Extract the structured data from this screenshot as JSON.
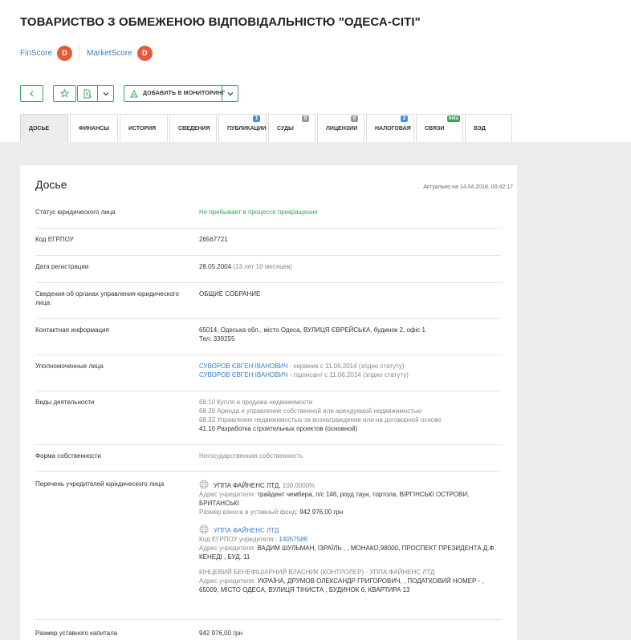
{
  "company": {
    "title": "ТОВАРИСТВО З ОБМЕЖЕНОЮ ВІДПОВІДАЛЬНІСТЮ \"ОДЕСА-СІТІ\""
  },
  "scores": [
    {
      "label": "FinScore",
      "grade": "D"
    },
    {
      "label": "MarketScore",
      "grade": "D"
    }
  ],
  "toolbar": {
    "monitor_label": "ДОБАВИТЬ В МОНИТОРИНГ"
  },
  "tabs": [
    {
      "label": "ДОСЬЕ"
    },
    {
      "label": "ФИНАНСЫ"
    },
    {
      "label": "ИСТОРИЯ"
    },
    {
      "label": "СВЕДЕНИЯ"
    },
    {
      "label": "ПУБЛИКАЦИИ",
      "badge": "1"
    },
    {
      "label": "СУДЫ",
      "badge": "0"
    },
    {
      "label": "ЛИЦЕНЗИИ",
      "badge": "0"
    },
    {
      "label": "НАЛОГОВАЯ",
      "badge": "2"
    },
    {
      "label": "СВЯЗИ",
      "badge": "beta"
    },
    {
      "label": "ВЭД"
    }
  ],
  "colors": {
    "accent": "#39a85a",
    "link": "#3a7ec2",
    "score": "#e65a3c",
    "badge_blue": "#4a90d9",
    "badge_gray": "#9a9a9a",
    "badge_green": "#3aa55a"
  },
  "dossier": {
    "title": "Досье",
    "updated": "Актуально на 14.04.2018, 00:42:17",
    "status": {
      "label": "Статус юридического лица",
      "value": "Не пребывает в процессе прекращения"
    },
    "edrpou": {
      "label": "Код ЕГРПОУ",
      "value": "26567721"
    },
    "registration": {
      "label": "Дата регистрации",
      "date": "28.05.2004",
      "age": "(13 лет 10 месяцев)"
    },
    "governance": {
      "label": "Сведения об органах управления юридического лица",
      "value": "ОБЩИЕ СОБРАНИЕ"
    },
    "contacts": {
      "label": "Контактная информация",
      "address": "65014, Одеська обл., місто Одеса, ВУЛИЦЯ ЄВРЕЙСЬКА, будинок 2, офіс 1",
      "phone": "Тел: 339255"
    },
    "authorized": {
      "label": "Уполномоченные лица",
      "persons": [
        {
          "name": "СУВОРОВ ЄВГЕН ІВАНОВИЧ",
          "role": " - керівник с 11.06.2014 (згідно статуту)"
        },
        {
          "name": "СУВОРОВ ЄВГЕН ІВАНОВИЧ",
          "role": " - підписант с 11.06.2014 (згідно статуту)"
        }
      ]
    },
    "activities": {
      "label": "Виды деятельности",
      "items": [
        "68.10 Купля и продажа недвижимости",
        "68.20 Аренда и управление собственной или арендуемой недвижимостью",
        "68.32 Управление недвижимостью за вознаграждение или на договорной основе",
        "41.10 Разработка строительных проектов (основной)"
      ]
    },
    "ownership": {
      "label": "Форма собственности",
      "value": "Негосударственная собственность"
    },
    "founders": {
      "label": "Перечень учредителей юридического лица",
      "f1_name": "УППА ФАЙНЕНС ЛТД,",
      "f1_share": "100,0000%",
      "f1_addr_label": "Адрес учредителя:",
      "f1_addr": "трайдент чембера, п/с 146, роуд таун, тортола, ВІРГІНСЬКІ ОСТРОВИ, БРИТАНСЬКІ",
      "f1_fund_label": "Размер взноса в уставный фонд:",
      "f1_fund": "942 976,00 грн",
      "f2_name": "УППА ФАЙНЕНС ЛТД",
      "f2_code_label": "Код ЕГРПОУ учредителя :",
      "f2_code": "14057586",
      "f2_addr_label": "Адрес учредителя:",
      "f2_addr": "ВАДИМ ШУЛЬМАН, ІЗРАЇЛЬ , , МОНАКО,98000, ПРОСПЕКТ ПРЕЗИДЕНТА Д.Ф. КЕНЕДІ , БУД. 11",
      "f3_name": "КІНЦЕВИЙ БЕНЕФІЦІАРНИЙ ВЛАСНИК (КОНТРОЛЕР) - УППА ФАЙНЕНС ЛТД",
      "f3_addr_label": "Адрес учредителя:",
      "f3_addr": "УКРАЇНА, ДРУМОВ ОЛЕКСАНДР ГРИГОРОВИЧ, , ПОДАТКОВИЙ НОМЕР - , 65009, МІСТО ОДЕСА, ВУЛИЦЯ ТІНИСТА , БУДИНОК 6, КВАРТИРА 13"
    },
    "capital": {
      "label": "Размер уставного капитала",
      "value": "942 976,00 грн"
    }
  }
}
